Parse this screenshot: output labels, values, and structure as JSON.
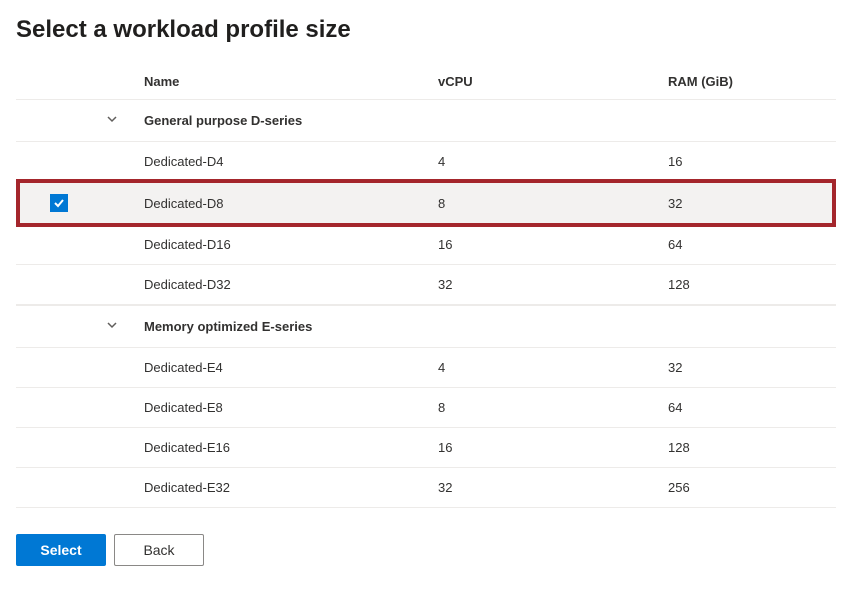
{
  "page_title": "Select a workload profile size",
  "columns": {
    "name": "Name",
    "vcpu": "vCPU",
    "ram": "RAM (GiB)"
  },
  "selected_row": "Dedicated-D8",
  "groups": [
    {
      "label": "General purpose D-series",
      "expanded": true,
      "rows": [
        {
          "name": "Dedicated-D4",
          "vcpu": "4",
          "ram": "16"
        },
        {
          "name": "Dedicated-D8",
          "vcpu": "8",
          "ram": "32"
        },
        {
          "name": "Dedicated-D16",
          "vcpu": "16",
          "ram": "64"
        },
        {
          "name": "Dedicated-D32",
          "vcpu": "32",
          "ram": "128"
        }
      ]
    },
    {
      "label": "Memory optimized E-series",
      "expanded": true,
      "rows": [
        {
          "name": "Dedicated-E4",
          "vcpu": "4",
          "ram": "32"
        },
        {
          "name": "Dedicated-E8",
          "vcpu": "8",
          "ram": "64"
        },
        {
          "name": "Dedicated-E16",
          "vcpu": "16",
          "ram": "128"
        },
        {
          "name": "Dedicated-E32",
          "vcpu": "32",
          "ram": "256"
        }
      ]
    }
  ],
  "footer": {
    "select_label": "Select",
    "back_label": "Back"
  }
}
